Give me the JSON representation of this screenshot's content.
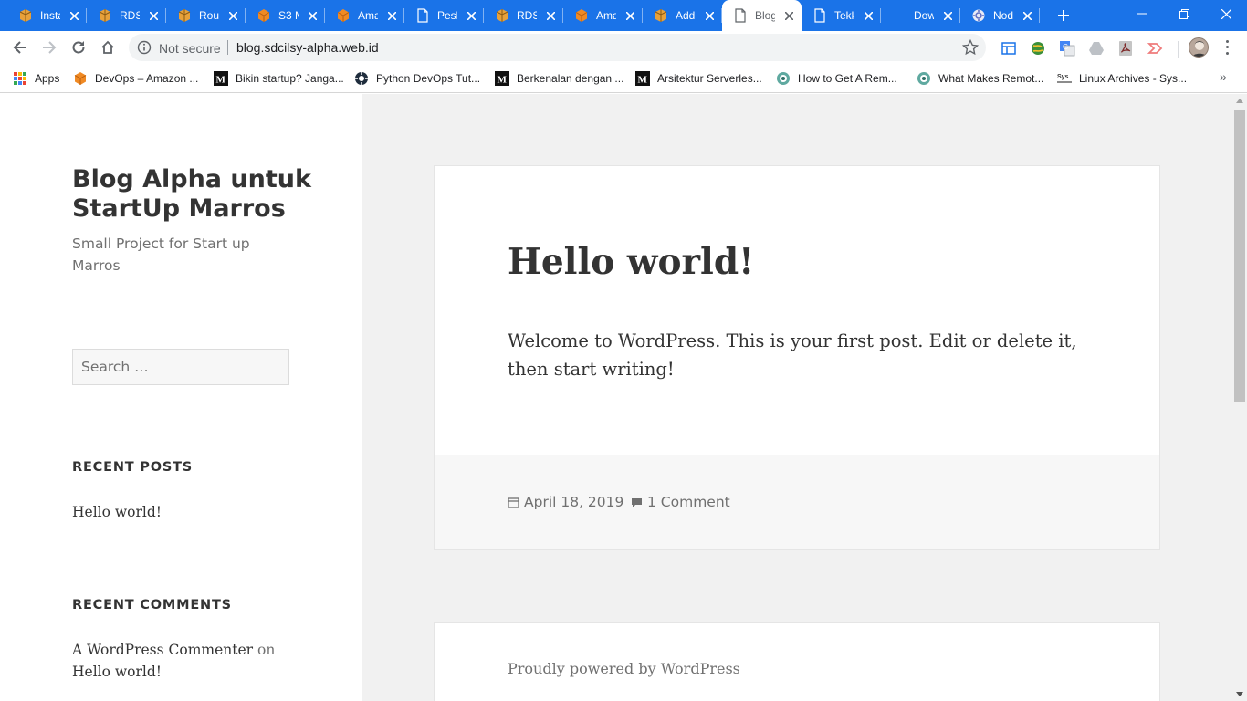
{
  "browser": {
    "tabs": [
      {
        "title": "Insta",
        "icon": "aws-box-icon",
        "active": false
      },
      {
        "title": "RDS",
        "icon": "aws-box-icon",
        "active": false
      },
      {
        "title": "Rout",
        "icon": "aws-box-icon",
        "active": false
      },
      {
        "title": "S3 M",
        "icon": "aws-cube-icon",
        "active": false
      },
      {
        "title": "Ama",
        "icon": "aws-cube-icon",
        "active": false
      },
      {
        "title": "Pesh",
        "icon": "page-icon",
        "active": false
      },
      {
        "title": "RDS",
        "icon": "aws-box-icon",
        "active": false
      },
      {
        "title": "Ama",
        "icon": "aws-cube-icon",
        "active": false
      },
      {
        "title": "Add",
        "icon": "aws-box-icon",
        "active": false
      },
      {
        "title": "Blog",
        "icon": "page-icon",
        "active": true
      },
      {
        "title": "Tekk",
        "icon": "page-icon",
        "active": false
      },
      {
        "title": "Dow",
        "icon": "blank-icon",
        "active": false
      },
      {
        "title": "Nod",
        "icon": "gear-icon",
        "active": false
      }
    ],
    "address": {
      "security_label": "Not secure",
      "url": "blog.sdcilsy-alpha.web.id"
    },
    "bookmarks": [
      {
        "label": "Apps",
        "icon": "apps-grid-icon"
      },
      {
        "label": "DevOps – Amazon ...",
        "icon": "aws-cube-icon"
      },
      {
        "label": "Bikin startup? Janga...",
        "icon": "medium-icon"
      },
      {
        "label": "Python DevOps Tut...",
        "icon": "compass-icon"
      },
      {
        "label": "Berkenalan dengan ...",
        "icon": "medium-icon"
      },
      {
        "label": "Arsitektur Serverles...",
        "icon": "medium-icon"
      },
      {
        "label": "How to Get A Rem...",
        "icon": "teal-circle-icon"
      },
      {
        "label": "What Makes Remot...",
        "icon": "teal-circle-icon"
      },
      {
        "label": "Linux Archives - Sys...",
        "icon": "sys-icon"
      }
    ]
  },
  "sidebar": {
    "site_title": "Blog Alpha untuk StartUp Marros",
    "site_description": "Small Project for Start up Marros",
    "search_placeholder": "Search …",
    "recent_posts_title": "RECENT POSTS",
    "recent_posts": [
      "Hello world!"
    ],
    "recent_comments_title": "RECENT COMMENTS",
    "recent_comment": {
      "author": "A WordPress Commenter",
      "on": "on",
      "post": "Hello world!"
    }
  },
  "post": {
    "title": "Hello world!",
    "body": "Welcome to WordPress. This is your first post. Edit or delete it, then start writing!",
    "date": "April 18, 2019",
    "comments": "1 Comment"
  },
  "footer": {
    "powered": "Proudly powered by WordPress"
  },
  "colors": {
    "tabstrip": "#1a73e8",
    "page_bg": "#f1f1f1",
    "text": "#333333",
    "muted": "#707070"
  }
}
